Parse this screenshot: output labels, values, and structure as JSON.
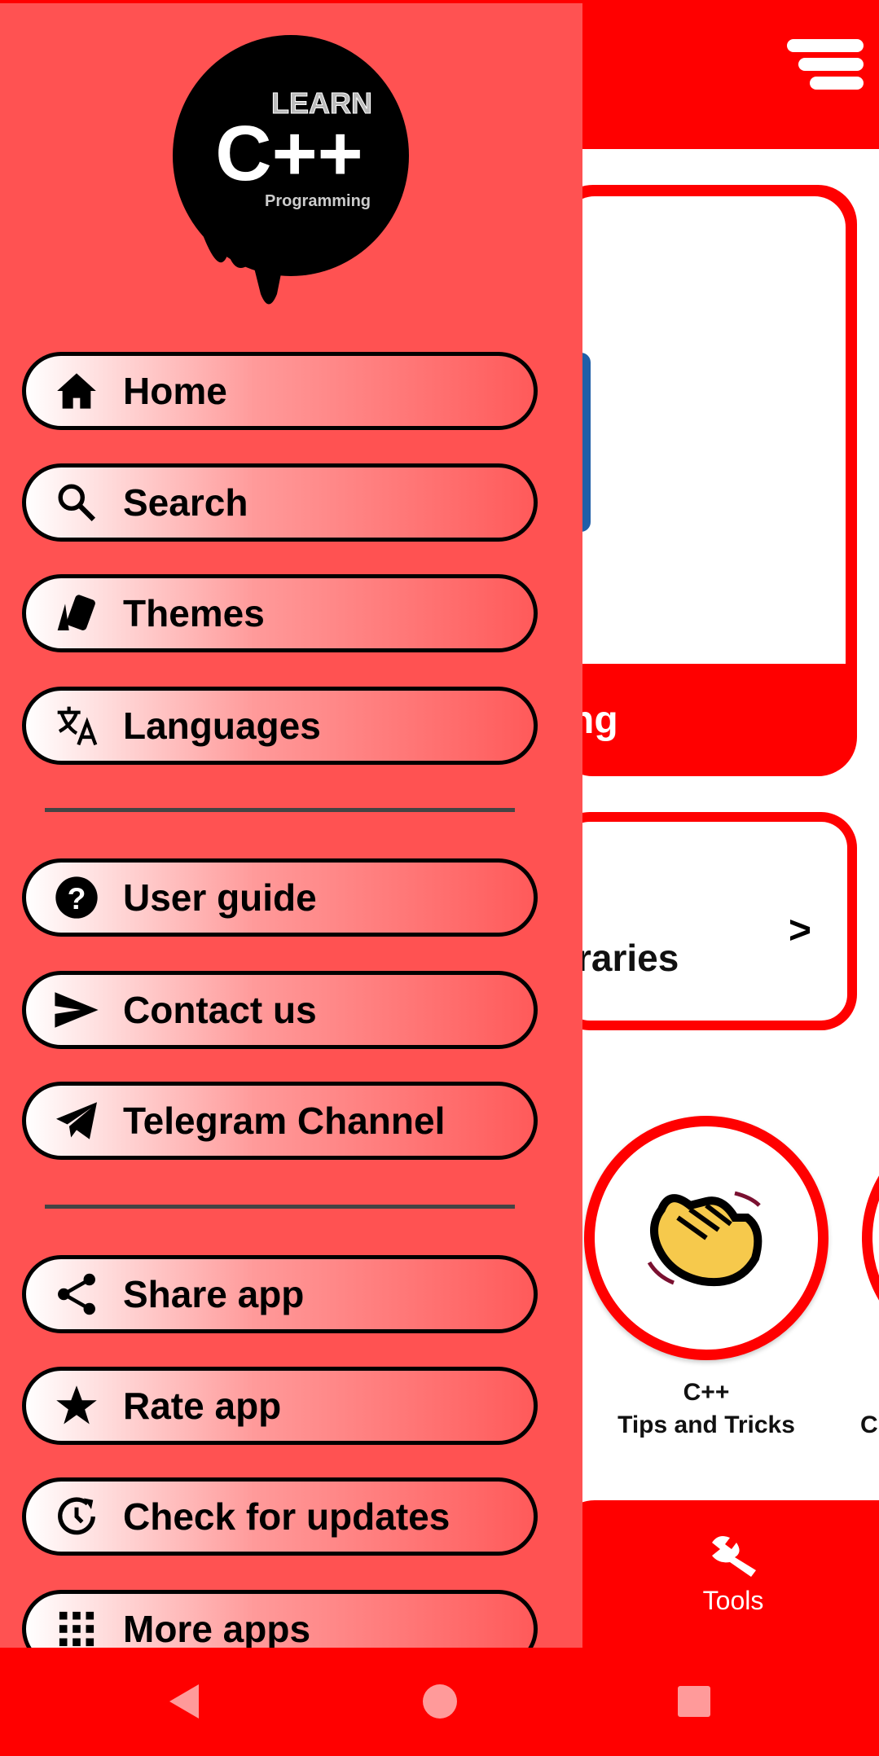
{
  "app": {
    "accent": "#ff0000",
    "drawer_bg": "#ff5252"
  },
  "header": {
    "menu_icon": "sort-menu-icon"
  },
  "logo": {
    "line1": "LEARN",
    "line2": "C++",
    "line3": "Programming"
  },
  "drawer": {
    "items": [
      {
        "label": "Home",
        "icon": "home-icon"
      },
      {
        "label": "Search",
        "icon": "search-icon"
      },
      {
        "label": "Themes",
        "icon": "themes-icon"
      },
      {
        "label": "Languages",
        "icon": "translate-icon"
      },
      {
        "label": "User guide",
        "icon": "help-icon"
      },
      {
        "label": "Contact us",
        "icon": "send-icon"
      },
      {
        "label": "Telegram Channel",
        "icon": "telegram-icon"
      },
      {
        "label": "Share app",
        "icon": "share-icon"
      },
      {
        "label": "Rate app",
        "icon": "star-icon"
      },
      {
        "label": "Check for updates",
        "icon": "update-icon"
      },
      {
        "label": "More apps",
        "icon": "apps-grid-icon"
      }
    ]
  },
  "main": {
    "card1_text": "ng",
    "card2_text": "raries",
    "tips": {
      "line1": "C++",
      "line2": "Tips and Tricks"
    },
    "next_label": "C"
  },
  "tabbar": {
    "tools_label": "Tools"
  }
}
